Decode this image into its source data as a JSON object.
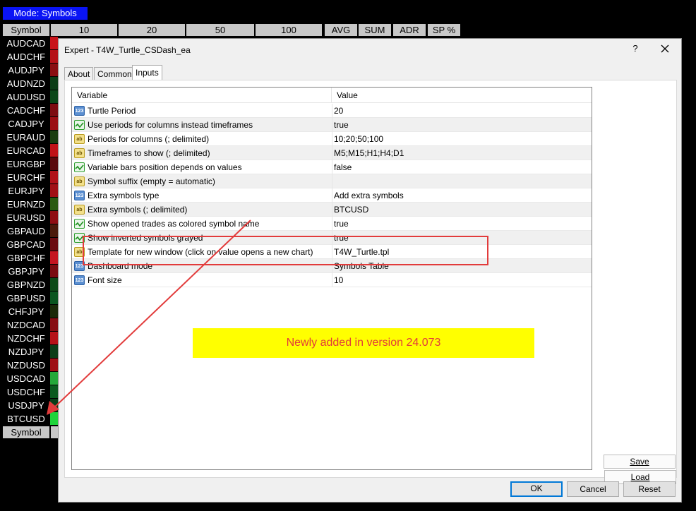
{
  "dashboard": {
    "mode_label": "Mode: Symbols",
    "columns": [
      "Symbol",
      "10",
      "20",
      "50",
      "100",
      "AVG",
      "SUM",
      "ADR",
      "SP %"
    ],
    "symbols": [
      "AUDCAD",
      "AUDCHF",
      "AUDJPY",
      "AUDNZD",
      "AUDUSD",
      "CADCHF",
      "CADJPY",
      "EURAUD",
      "EURCAD",
      "EURGBP",
      "EURCHF",
      "EURJPY",
      "EURNZD",
      "EURUSD",
      "GBPAUD",
      "GBPCAD",
      "GBPCHF",
      "GBPJPY",
      "GBPNZD",
      "GBPUSD",
      "CHFJPY",
      "NZDCAD",
      "NZDCHF",
      "NZDJPY",
      "NZDUSD",
      "USDCAD",
      "USDCHF",
      "USDJPY",
      "BTCUSD"
    ],
    "cell_colors": [
      "#c8141a",
      "#b51218",
      "#8a0e12",
      "#0c3d17",
      "#0b4719",
      "#7d0d12",
      "#9b0f14",
      "#1a3d10",
      "#c01318",
      "#5a0a0d",
      "#b01219",
      "#a11016",
      "#2a5a12",
      "#8f0e13",
      "#4b1a0b",
      "#6a0b10",
      "#c51520",
      "#7a0c10",
      "#0d4a18",
      "#0a5620",
      "#1b2a09",
      "#870e13",
      "#b61218",
      "#0c3d18",
      "#9e1016",
      "#25a83a",
      "#0b5b1f",
      "#0a3d17",
      "#1fd43b"
    ],
    "bottom_label": "Symbol"
  },
  "dialog": {
    "title": "Expert - T4W_Turtle_CSDash_ea",
    "help_label": "?",
    "tabs": [
      "About",
      "Common",
      "Inputs"
    ],
    "headers": {
      "variable": "Variable",
      "value": "Value"
    },
    "rows": [
      {
        "icon": "num",
        "variable": "Turtle Period",
        "value": "20"
      },
      {
        "icon": "bool",
        "variable": "Use periods for columns instead timeframes",
        "value": "true"
      },
      {
        "icon": "str",
        "variable": "Periods for columns (; delimited)",
        "value": "10;20;50;100"
      },
      {
        "icon": "str",
        "variable": "Timeframes to show (; delimited)",
        "value": "M5;M15;H1;H4;D1"
      },
      {
        "icon": "bool",
        "variable": "Variable bars position depends on values",
        "value": "false"
      },
      {
        "icon": "str",
        "variable": "Symbol suffix (empty = automatic)",
        "value": ""
      },
      {
        "icon": "num",
        "variable": "Extra symbols type",
        "value": "Add extra symbols"
      },
      {
        "icon": "str",
        "variable": "Extra symbols (; delimited)",
        "value": "BTCUSD"
      },
      {
        "icon": "bool",
        "variable": "Show opened trades as colored symbol name",
        "value": "true"
      },
      {
        "icon": "bool",
        "variable": "Show inverted symbols grayed",
        "value": "true"
      },
      {
        "icon": "str",
        "variable": "Template for new window (click on value opens a new chart)",
        "value": "T4W_Turtle.tpl"
      },
      {
        "icon": "num",
        "variable": "Dashboard mode",
        "value": "Symbols Table"
      },
      {
        "icon": "num",
        "variable": "Font size",
        "value": "10"
      }
    ],
    "icon_labels": {
      "num": "123",
      "bool": "",
      "str": "ab"
    },
    "note": "Newly added in version 24.073",
    "buttons": {
      "load": "Load",
      "save": "Save",
      "ok": "OK",
      "cancel": "Cancel",
      "reset": "Reset"
    },
    "colors": {
      "highlight": "#e23b3b",
      "note_bg": "#ffff00",
      "accent": "#0078d7"
    }
  }
}
